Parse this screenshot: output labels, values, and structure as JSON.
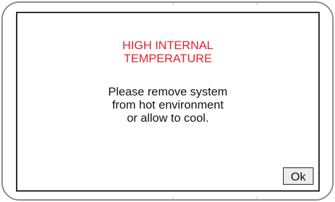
{
  "dialog": {
    "title_lines": [
      "HIGH INTERNAL",
      "TEMPERATURE"
    ],
    "message_lines": [
      "Please remove system",
      "from hot environment",
      "or allow to cool."
    ],
    "ok_label": "Ok"
  },
  "colors": {
    "title": "#e8202a",
    "message": "#111111",
    "screen_border": "#2b2b2b",
    "bezel": "#8a8a8a",
    "button_bg": "#ececec"
  }
}
